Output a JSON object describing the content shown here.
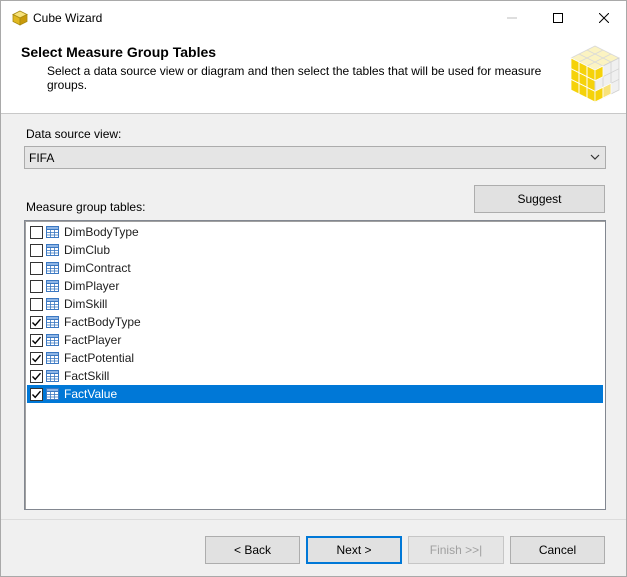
{
  "window": {
    "title": "Cube Wizard",
    "icon": "cube-icon",
    "controls": [
      "minimize-icon",
      "maximize-icon",
      "close-icon"
    ]
  },
  "header": {
    "title": "Select Measure Group Tables",
    "description": "Select a data source view or diagram and then select the tables that will be used for measure groups.",
    "image": "cube-graphic-icon"
  },
  "data_source": {
    "label": "Data source view:",
    "selected": "FIFA"
  },
  "measure_group": {
    "label": "Measure group tables:",
    "suggest_label": "Suggest",
    "items": [
      {
        "label": "DimBodyType",
        "checked": false,
        "selected": false
      },
      {
        "label": "DimClub",
        "checked": false,
        "selected": false
      },
      {
        "label": "DimContract",
        "checked": false,
        "selected": false
      },
      {
        "label": "DimPlayer",
        "checked": false,
        "selected": false
      },
      {
        "label": "DimSkill",
        "checked": false,
        "selected": false
      },
      {
        "label": "FactBodyType",
        "checked": true,
        "selected": false
      },
      {
        "label": "FactPlayer",
        "checked": true,
        "selected": false
      },
      {
        "label": "FactPotential",
        "checked": true,
        "selected": false
      },
      {
        "label": "FactSkill",
        "checked": true,
        "selected": false
      },
      {
        "label": "FactValue",
        "checked": true,
        "selected": true
      }
    ]
  },
  "footer": {
    "back_label": "< Back",
    "next_label": "Next >",
    "finish_label": "Finish >>|",
    "cancel_label": "Cancel"
  },
  "colors": {
    "selection": "#0078d7",
    "cube_yellow": "#f5d20a"
  }
}
